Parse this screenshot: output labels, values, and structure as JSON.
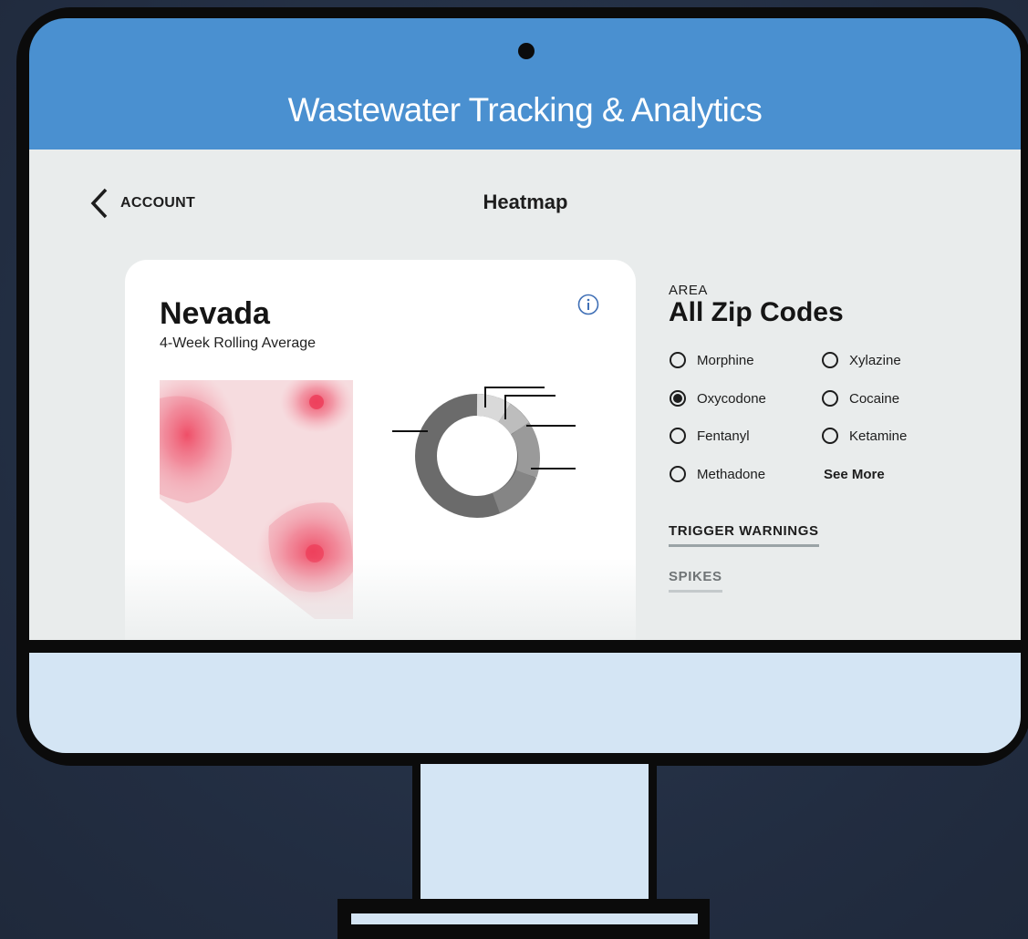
{
  "app": {
    "title": "Wastewater Tracking & Analytics"
  },
  "header": {
    "back_label": "ACCOUNT",
    "page_title": "Heatmap"
  },
  "card": {
    "title": "Nevada",
    "subtitle": "4-Week Rolling Average"
  },
  "area": {
    "label": "AREA",
    "value": "All Zip Codes"
  },
  "substances": [
    {
      "label": "Morphine",
      "selected": false
    },
    {
      "label": "Xylazine",
      "selected": false
    },
    {
      "label": "Oxycodone",
      "selected": true
    },
    {
      "label": "Cocaine",
      "selected": false
    },
    {
      "label": "Fentanyl",
      "selected": false
    },
    {
      "label": "Ketamine",
      "selected": false
    },
    {
      "label": "Methadone",
      "selected": false
    }
  ],
  "see_more_label": "See More",
  "links": {
    "trigger_warnings": "TRIGGER WARNINGS",
    "spikes": "SPIKES"
  },
  "colors": {
    "header_blue": "#4a90d0",
    "heat_red": "#ee3b57",
    "screen_bg": "#e9ecec"
  }
}
